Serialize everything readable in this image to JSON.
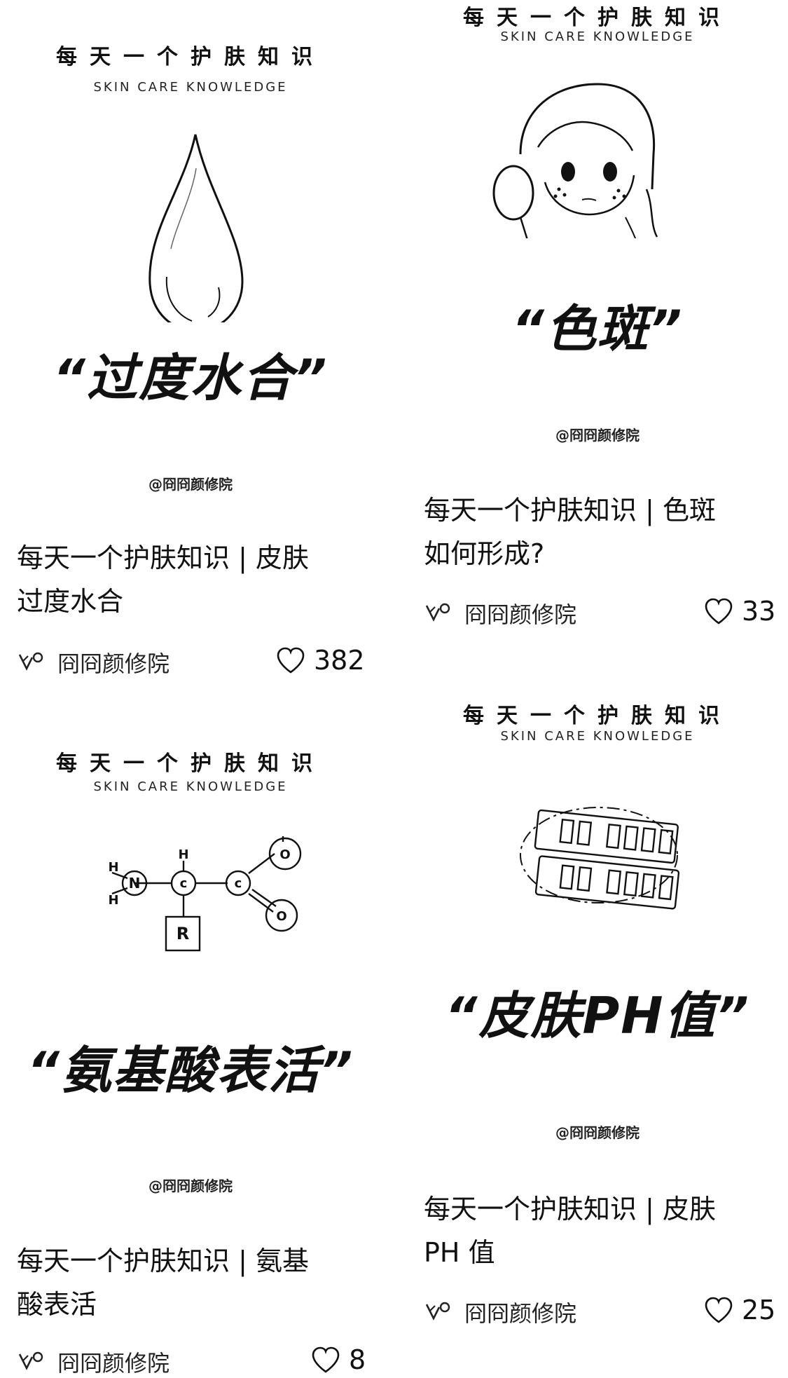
{
  "cards": [
    {
      "brand_cn": "每天一个护肤知识",
      "brand_en": "SKIN CARE KNOWLEDGE",
      "quote": "“过度水合”",
      "watermark": "@冏冏颜修院",
      "title_line1": "每天一个护肤知识 | 皮肤",
      "title_line2": "过度水合",
      "author": "冏冏颜修院",
      "likes": "382",
      "illustration": "water-drop"
    },
    {
      "brand_cn": "每天一个护肤知识",
      "brand_en": "SKIN CARE KNOWLEDGE",
      "quote": "“色斑”",
      "watermark": "@冏冏颜修院",
      "title_line1": "每天一个护肤知识 | 色斑",
      "title_line2": "如何形成?",
      "author": "冏冏颜修院",
      "likes": "33",
      "illustration": "girl-with-mirror"
    },
    {
      "brand_cn": "每天一个护肤知识",
      "brand_en": "SKIN CARE KNOWLEDGE",
      "quote": "“氨基酸表活”",
      "watermark": "@冏冏颜修院",
      "title_line1": "每天一个护肤知识 | 氨基",
      "title_line2": "酸表活",
      "author": "冏冏颜修院",
      "likes": "8",
      "illustration": "amino-acid-structure",
      "molecule_labels": {
        "h_top": "H",
        "h_upper_left": "H",
        "h_lower_left": "H",
        "h_carbon": "H",
        "n": "N",
        "c1": "c",
        "c2": "c",
        "o1": "O",
        "o2": "O",
        "r": "R"
      }
    },
    {
      "brand_cn": "每天一个护肤知识",
      "brand_en": "SKIN CARE KNOWLEDGE",
      "quote": "“皮肤PH值”",
      "watermark": "@冏冏颜修院",
      "title_line1": "每天一个护肤知识 | 皮肤",
      "title_line2": "PH 值",
      "author": "冏冏颜修院",
      "likes": "25",
      "illustration": "ph-test-strip"
    }
  ],
  "icons": {
    "author": "author-mark-icon",
    "like": "heart-icon"
  }
}
